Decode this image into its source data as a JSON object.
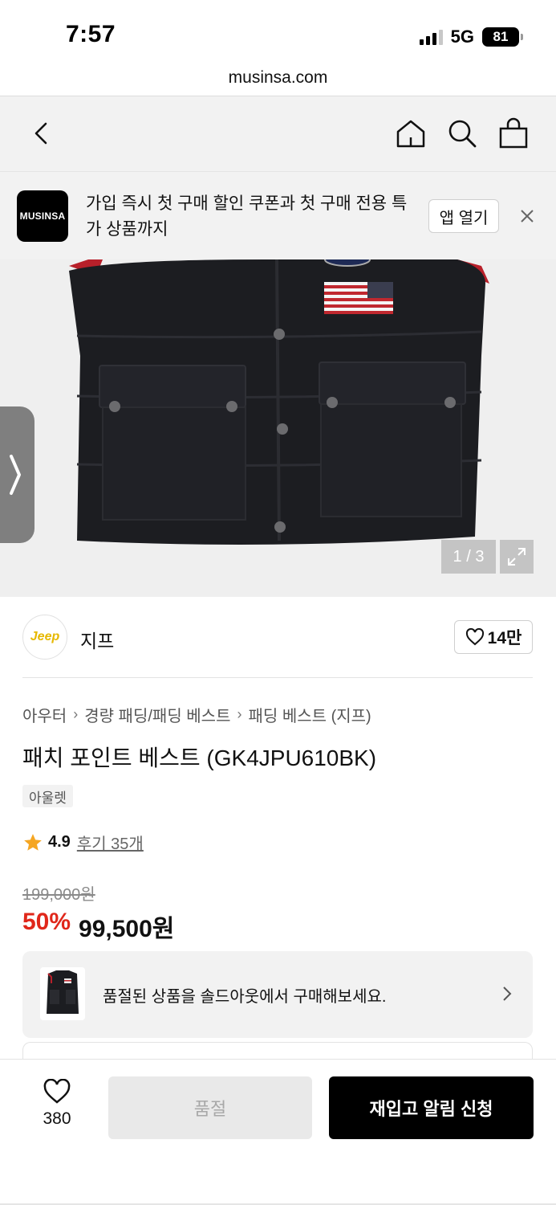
{
  "status_bar": {
    "time": "7:57",
    "network": "5G",
    "battery": "81"
  },
  "browser": {
    "url": "musinsa.com"
  },
  "header": {
    "icons": [
      "back-icon",
      "home-icon",
      "search-icon",
      "bag-icon"
    ]
  },
  "banner": {
    "logo": "MUSINSA",
    "text": "가입 즉시 첫 구매 할인 쿠폰과 첫 구매 전용 특가 상품까지",
    "open_app": "앱 열기"
  },
  "gallery": {
    "counter": "1 / 3"
  },
  "brand": {
    "logo_text": "Jeep",
    "name": "지프",
    "likes": "14만"
  },
  "breadcrumb": [
    "아우터",
    "경량 패딩/패딩 베스트",
    "패딩 베스트 (지프)"
  ],
  "product": {
    "title": "패치 포인트 베스트 (GK4JPU610BK)",
    "tag": "아울렛",
    "rating": "4.9",
    "reviews": "후기 35개",
    "original_price": "199,000원",
    "discount": "50%",
    "sale_price": "99,500원"
  },
  "soldout_card": {
    "text": "품절된 상품을 솔드아웃에서 구매해보세요."
  },
  "bottom_bar": {
    "wish_count": "380",
    "soldout_label": "품절",
    "restock_label": "재입고 알림 신청"
  },
  "colors": {
    "accent": "#e0271a",
    "primary": "#000000",
    "background": "#f2f2f2"
  }
}
